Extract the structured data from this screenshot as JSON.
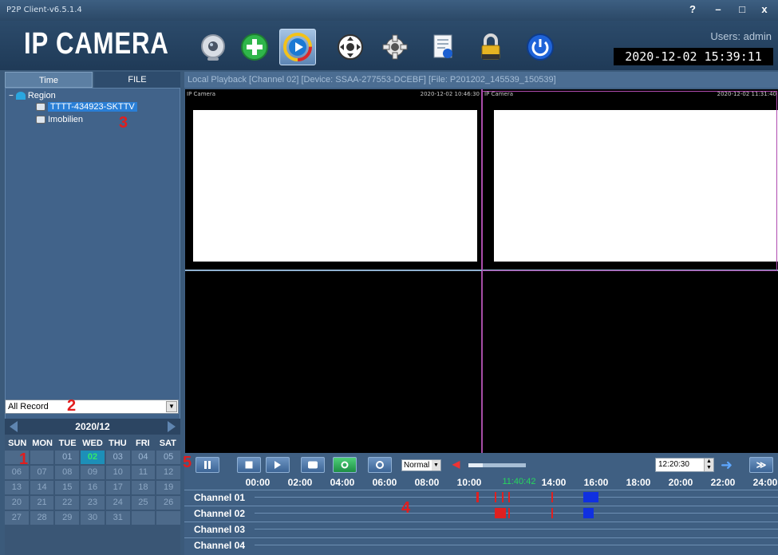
{
  "window": {
    "title": "P2P Client-v6.5.1.4",
    "buttons": [
      "?",
      "–",
      "□",
      "x"
    ]
  },
  "header": {
    "brand": "IP CAMERA",
    "tools": [
      {
        "name": "webcam-icon"
      },
      {
        "name": "add-icon"
      },
      {
        "name": "playback-icon",
        "active": true
      },
      {
        "name": "ptz-icon"
      },
      {
        "name": "settings-gear-icon"
      },
      {
        "name": "log-document-icon"
      },
      {
        "name": "lock-icon"
      },
      {
        "name": "power-icon"
      }
    ],
    "users": "Users: admin",
    "datetime": "2020-12-02  15:39:11"
  },
  "left": {
    "tabs": [
      "Time",
      "FILE"
    ],
    "tree": {
      "root": "Region",
      "devices": [
        "TTTT-434923-SKTTV",
        "Imobilien"
      ]
    },
    "record_select": "All Record",
    "calendar": {
      "month": "2020/12",
      "weekdays": [
        "SUN",
        "MON",
        "TUE",
        "WED",
        "THU",
        "FRI",
        "SAT"
      ],
      "days": [
        "",
        "",
        "01",
        "02",
        "03",
        "04",
        "05",
        "06",
        "07",
        "08",
        "09",
        "10",
        "11",
        "12",
        "13",
        "14",
        "15",
        "16",
        "17",
        "18",
        "19",
        "20",
        "21",
        "22",
        "23",
        "24",
        "25",
        "26",
        "27",
        "28",
        "29",
        "30",
        "31",
        "",
        ""
      ],
      "today": "02"
    }
  },
  "main": {
    "playback_title": "Local Playback [Channel 02] [Device: SSAA-277553-DCEBF] [File: P201202_145539_150539]",
    "osd": {
      "cell1_left": "IP Camera",
      "cell1_right": "2020-12-02  10:46:30",
      "cell2_left": "IP Camera",
      "cell2_right": "2020-12-02 11:31:40"
    },
    "speed": "Normal",
    "volume_level": 0.25,
    "time_input": "12:20:30",
    "timeline": {
      "ticks": [
        "00:00",
        "02:00",
        "04:00",
        "06:00",
        "08:00",
        "10:00",
        "11:40:42",
        "14:00",
        "16:00",
        "18:00",
        "20:00",
        "22:00",
        "24:00"
      ],
      "channels": [
        "Channel 01",
        "Channel 02",
        "Channel 03",
        "Channel 04"
      ]
    }
  },
  "annotations": [
    "1",
    "2",
    "3",
    "4",
    "5"
  ]
}
